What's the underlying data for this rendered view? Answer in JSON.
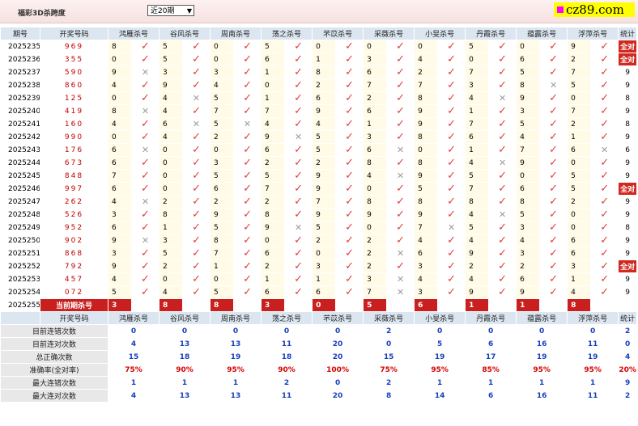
{
  "header": {
    "title": "福彩3D杀跨度",
    "period_select": "近20期",
    "site_label": "cz89.com"
  },
  "columns": {
    "period": "期号",
    "numbers": "开奖号码",
    "stat": "统计",
    "methods": [
      "鸿雁杀号",
      "谷风杀号",
      "周南杀号",
      "荡之杀号",
      "芣苡杀号",
      "采薇杀号",
      "小旻杀号",
      "丹霞杀号",
      "蕴露杀号",
      "浮萍杀号"
    ]
  },
  "rows": [
    {
      "period": "2025235",
      "numbers": "969",
      "vals": [
        "8",
        "5",
        "0",
        "5",
        "0",
        "0",
        "0",
        "5",
        "0",
        "9"
      ],
      "marks": [
        "ok",
        "ok",
        "ok",
        "ok",
        "ok",
        "ok",
        "ok",
        "ok",
        "ok",
        "ok"
      ],
      "stat": "全对"
    },
    {
      "period": "2025236",
      "numbers": "355",
      "vals": [
        "0",
        "5",
        "0",
        "6",
        "1",
        "3",
        "4",
        "0",
        "6",
        "2"
      ],
      "marks": [
        "ok",
        "ok",
        "ok",
        "ok",
        "ok",
        "ok",
        "ok",
        "ok",
        "ok",
        "ok"
      ],
      "stat": "全对"
    },
    {
      "period": "2025237",
      "numbers": "590",
      "vals": [
        "9",
        "3",
        "3",
        "1",
        "8",
        "6",
        "2",
        "7",
        "5",
        "7"
      ],
      "marks": [
        "ng",
        "ok",
        "ok",
        "ok",
        "ok",
        "ok",
        "ok",
        "ok",
        "ok",
        "ok"
      ],
      "stat": "9"
    },
    {
      "period": "2025238",
      "numbers": "860",
      "vals": [
        "4",
        "9",
        "4",
        "0",
        "2",
        "7",
        "7",
        "3",
        "8",
        "5"
      ],
      "marks": [
        "ok",
        "ok",
        "ok",
        "ok",
        "ok",
        "ok",
        "ok",
        "ok",
        "ng",
        "ok"
      ],
      "stat": "9"
    },
    {
      "period": "2025239",
      "numbers": "125",
      "vals": [
        "0",
        "4",
        "5",
        "1",
        "6",
        "2",
        "8",
        "4",
        "9",
        "0"
      ],
      "marks": [
        "ok",
        "ng",
        "ok",
        "ok",
        "ok",
        "ok",
        "ok",
        "ng",
        "ok",
        "ok"
      ],
      "stat": "8"
    },
    {
      "period": "2025240",
      "numbers": "419",
      "vals": [
        "8",
        "4",
        "7",
        "7",
        "9",
        "6",
        "9",
        "1",
        "3",
        "7"
      ],
      "marks": [
        "ng",
        "ok",
        "ok",
        "ok",
        "ok",
        "ok",
        "ok",
        "ok",
        "ok",
        "ok"
      ],
      "stat": "9"
    },
    {
      "period": "2025241",
      "numbers": "160",
      "vals": [
        "4",
        "6",
        "5",
        "4",
        "4",
        "1",
        "9",
        "7",
        "5",
        "2"
      ],
      "marks": [
        "ok",
        "ng",
        "ng",
        "ok",
        "ok",
        "ok",
        "ok",
        "ok",
        "ok",
        "ok"
      ],
      "stat": "8"
    },
    {
      "period": "2025242",
      "numbers": "990",
      "vals": [
        "0",
        "4",
        "2",
        "9",
        "5",
        "3",
        "8",
        "6",
        "4",
        "1"
      ],
      "marks": [
        "ok",
        "ok",
        "ok",
        "ng",
        "ok",
        "ok",
        "ok",
        "ok",
        "ok",
        "ok"
      ],
      "stat": "9"
    },
    {
      "period": "2025243",
      "numbers": "176",
      "vals": [
        "6",
        "0",
        "0",
        "6",
        "5",
        "6",
        "0",
        "1",
        "7",
        "6"
      ],
      "marks": [
        "ng",
        "ok",
        "ok",
        "ok",
        "ok",
        "ng",
        "ok",
        "ok",
        "ok",
        "ng"
      ],
      "stat": "6"
    },
    {
      "period": "2025244",
      "numbers": "673",
      "vals": [
        "6",
        "0",
        "3",
        "2",
        "2",
        "8",
        "8",
        "4",
        "9",
        "0"
      ],
      "marks": [
        "ok",
        "ok",
        "ok",
        "ok",
        "ok",
        "ok",
        "ok",
        "ng",
        "ok",
        "ok"
      ],
      "stat": "9"
    },
    {
      "period": "2025245",
      "numbers": "848",
      "vals": [
        "7",
        "0",
        "5",
        "5",
        "9",
        "4",
        "9",
        "5",
        "0",
        "5"
      ],
      "marks": [
        "ok",
        "ok",
        "ok",
        "ok",
        "ok",
        "ng",
        "ok",
        "ok",
        "ok",
        "ok"
      ],
      "stat": "9"
    },
    {
      "period": "2025246",
      "numbers": "997",
      "vals": [
        "6",
        "0",
        "6",
        "7",
        "9",
        "0",
        "5",
        "7",
        "6",
        "5"
      ],
      "marks": [
        "ok",
        "ok",
        "ok",
        "ok",
        "ok",
        "ok",
        "ok",
        "ok",
        "ok",
        "ok"
      ],
      "stat": "全对"
    },
    {
      "period": "2025247",
      "numbers": "262",
      "vals": [
        "4",
        "2",
        "2",
        "2",
        "7",
        "8",
        "8",
        "8",
        "8",
        "2"
      ],
      "marks": [
        "ng",
        "ok",
        "ok",
        "ok",
        "ok",
        "ok",
        "ok",
        "ok",
        "ok",
        "ok"
      ],
      "stat": "9"
    },
    {
      "period": "2025248",
      "numbers": "526",
      "vals": [
        "3",
        "8",
        "9",
        "8",
        "9",
        "9",
        "9",
        "4",
        "5",
        "0"
      ],
      "marks": [
        "ok",
        "ok",
        "ok",
        "ok",
        "ok",
        "ok",
        "ok",
        "ng",
        "ok",
        "ok"
      ],
      "stat": "9"
    },
    {
      "period": "2025249",
      "numbers": "952",
      "vals": [
        "6",
        "1",
        "5",
        "9",
        "5",
        "0",
        "7",
        "5",
        "3",
        "0"
      ],
      "marks": [
        "ok",
        "ok",
        "ok",
        "ng",
        "ok",
        "ok",
        "ng",
        "ok",
        "ok",
        "ok"
      ],
      "stat": "8"
    },
    {
      "period": "2025250",
      "numbers": "902",
      "vals": [
        "9",
        "3",
        "8",
        "0",
        "2",
        "2",
        "4",
        "4",
        "4",
        "6"
      ],
      "marks": [
        "ng",
        "ok",
        "ok",
        "ok",
        "ok",
        "ok",
        "ok",
        "ok",
        "ok",
        "ok"
      ],
      "stat": "9"
    },
    {
      "period": "2025251",
      "numbers": "868",
      "vals": [
        "3",
        "5",
        "7",
        "6",
        "0",
        "2",
        "6",
        "9",
        "3",
        "6"
      ],
      "marks": [
        "ok",
        "ok",
        "ok",
        "ok",
        "ok",
        "ng",
        "ok",
        "ok",
        "ok",
        "ok"
      ],
      "stat": "9"
    },
    {
      "period": "2025252",
      "numbers": "792",
      "vals": [
        "9",
        "2",
        "1",
        "2",
        "3",
        "2",
        "3",
        "2",
        "2",
        "3"
      ],
      "marks": [
        "ok",
        "ok",
        "ok",
        "ok",
        "ok",
        "ok",
        "ok",
        "ok",
        "ok",
        "ok"
      ],
      "stat": "全对"
    },
    {
      "period": "2025253",
      "numbers": "457",
      "vals": [
        "4",
        "0",
        "0",
        "1",
        "1",
        "3",
        "4",
        "4",
        "6",
        "1"
      ],
      "marks": [
        "ok",
        "ok",
        "ok",
        "ok",
        "ok",
        "ng",
        "ok",
        "ok",
        "ok",
        "ok"
      ],
      "stat": "9"
    },
    {
      "period": "2025254",
      "numbers": "072",
      "vals": [
        "5",
        "4",
        "5",
        "6",
        "6",
        "7",
        "3",
        "9",
        "9",
        "4"
      ],
      "marks": [
        "ok",
        "ok",
        "ok",
        "ok",
        "ok",
        "ng",
        "ok",
        "ok",
        "ok",
        "ok"
      ],
      "stat": "9"
    }
  ],
  "current": {
    "period": "2025255",
    "label": "当前期杀号",
    "vals": [
      "3",
      "8",
      "8",
      "3",
      "0",
      "5",
      "6",
      "1",
      "1",
      "8"
    ]
  },
  "stats": [
    {
      "label": "目前连错次数",
      "vals": [
        "0",
        "0",
        "0",
        "0",
        "0",
        "2",
        "0",
        "0",
        "0",
        "0"
      ],
      "stat": "2"
    },
    {
      "label": "目前连对次数",
      "vals": [
        "4",
        "13",
        "13",
        "11",
        "20",
        "0",
        "5",
        "6",
        "16",
        "11"
      ],
      "stat": "0"
    },
    {
      "label": "总正确次数",
      "vals": [
        "15",
        "18",
        "19",
        "18",
        "20",
        "15",
        "19",
        "17",
        "19",
        "19"
      ],
      "stat": "4"
    },
    {
      "label": "准确率(全对率)",
      "vals": [
        "75%",
        "90%",
        "95%",
        "90%",
        "100%",
        "75%",
        "95%",
        "85%",
        "95%",
        "95%"
      ],
      "stat": "20%"
    },
    {
      "label": "最大连错次数",
      "vals": [
        "1",
        "1",
        "1",
        "2",
        "0",
        "2",
        "1",
        "1",
        "1",
        "1"
      ],
      "stat": "9"
    },
    {
      "label": "最大连对次数",
      "vals": [
        "4",
        "13",
        "13",
        "11",
        "20",
        "8",
        "14",
        "6",
        "16",
        "11"
      ],
      "stat": "2"
    }
  ],
  "icons": {
    "correct": "check-icon",
    "wrong": "cross-icon"
  },
  "colors": {
    "header_bg": "#dce6f0",
    "accent_red": "#c91f1f",
    "stat_blue": "#1a3fbf",
    "check_red": "#e23c3c"
  }
}
